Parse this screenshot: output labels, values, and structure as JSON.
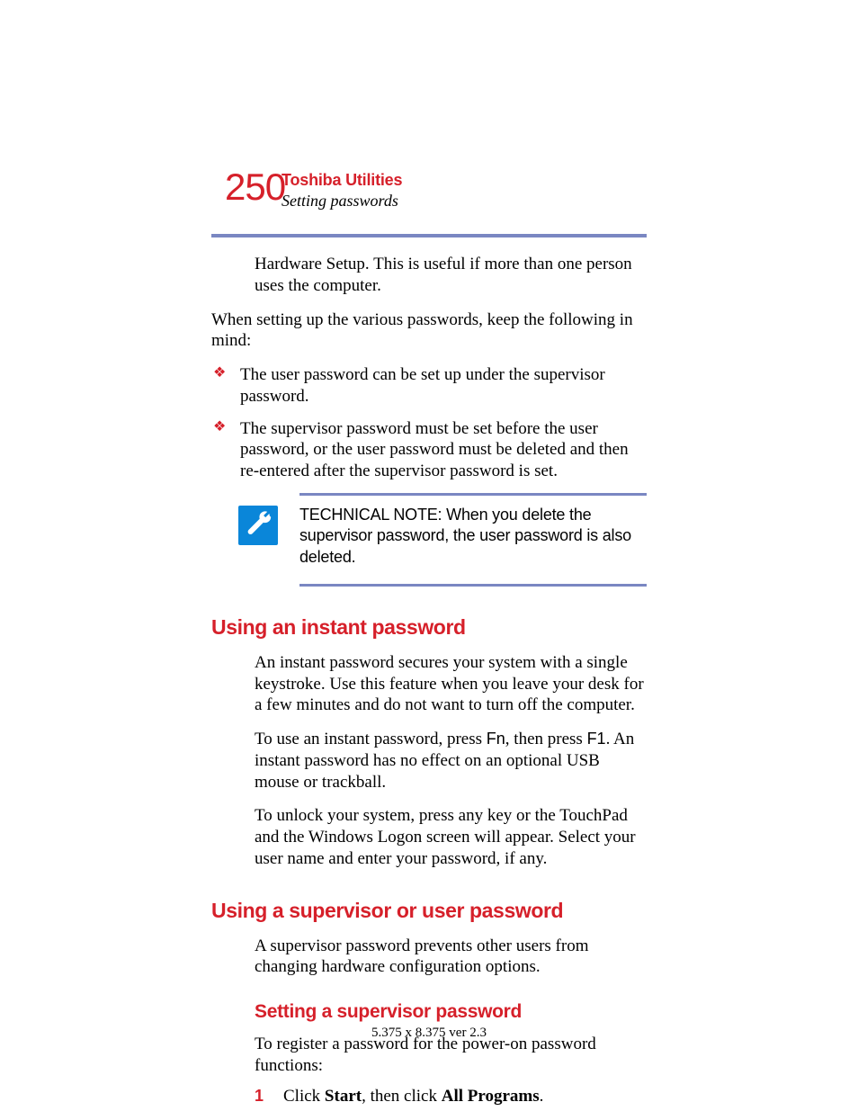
{
  "header": {
    "page_number": "250",
    "chapter": "Toshiba Utilities",
    "section": "Setting passwords"
  },
  "intro": {
    "p1": "Hardware Setup. This is useful if more than one person uses the computer.",
    "p2": "When setting up the various passwords, keep the following in mind:",
    "bullets": [
      "The user password can be set up under the supervisor password.",
      "The supervisor password must be set before the user password, or the user password must be deleted and then re-entered after the supervisor password is set."
    ]
  },
  "tech_note": {
    "label": "TECHNICAL NOTE: ",
    "text": "When you delete the supervisor password, the user password is also deleted."
  },
  "instant": {
    "heading": "Using an instant password",
    "p1": "An instant password secures your system with a single keystroke. Use this feature when you leave your desk for a few minutes and do not want to turn off the computer.",
    "p2a": "To use an instant password, press ",
    "p2_fn": "Fn",
    "p2b": ", then press ",
    "p2_f1": "F1",
    "p2c": ". An instant password has no effect on an optional USB mouse or trackball.",
    "p3": "To unlock your system, press any key or the TouchPad and the Windows Logon screen will appear. Select your user name and enter your password, if any."
  },
  "supervisor": {
    "heading": "Using a supervisor or user password",
    "p1": "A supervisor password prevents other users from changing hardware configuration options."
  },
  "setting": {
    "heading": "Setting a supervisor password",
    "p1": "To register a password for the power-on password functions:",
    "step1_num": "1",
    "step1_a": "Click ",
    "step1_b": "Start",
    "step1_c": ", then click ",
    "step1_d": "All Programs",
    "step1_e": "."
  },
  "footer": "5.375 x 8.375 ver 2.3"
}
